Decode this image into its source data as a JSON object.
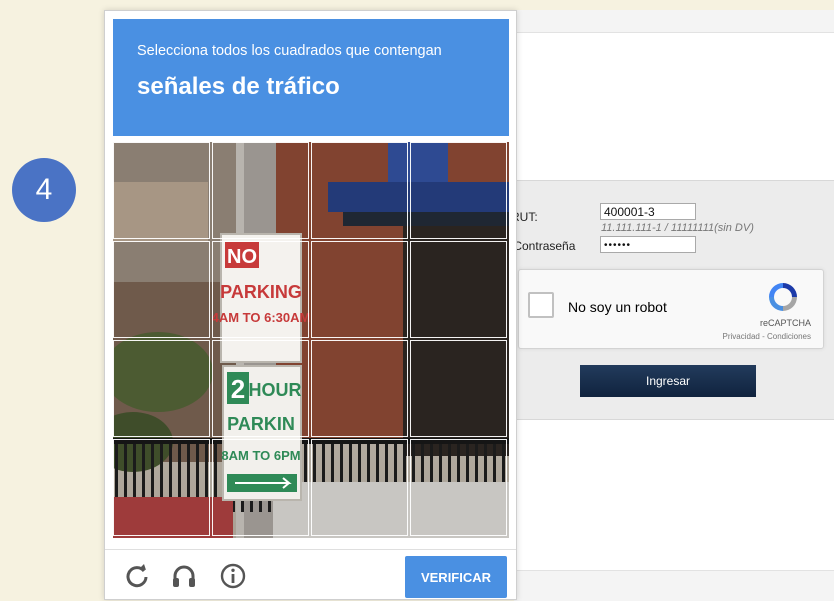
{
  "step_badge": "4",
  "challenge": {
    "instruction": "Selecciona todos los cuadrados que contengan",
    "target": "señales de tráfico",
    "tiles": [
      "",
      "",
      "",
      "",
      "",
      "",
      "",
      "",
      "",
      "",
      "",
      "",
      "",
      "",
      "",
      ""
    ],
    "footer": {
      "reload_icon": "reload-icon",
      "audio_icon": "headphones-icon",
      "info_icon": "info-icon",
      "verify_label": "VERIFICAR"
    },
    "sign_text": {
      "line1": "NO",
      "line2": "PARKING",
      "line3": "4AM TO 6:30AM",
      "line4": "2",
      "line5": "HOUR",
      "line6": "PARKIN",
      "line7": "8AM TO 6PM"
    },
    "accent_color": "#4a90e2"
  },
  "login": {
    "rut_label": "RUT:",
    "rut_value": "400001-3",
    "rut_hint": "11.111.111-1 / 11111111(sin DV)",
    "password_label": "Contraseña:",
    "password_value": "••••••",
    "captcha_label": "No soy un robot",
    "captcha_brand": "reCAPTCHA",
    "captcha_links": "Privacidad - Condiciones",
    "submit_label": "Ingresar"
  }
}
